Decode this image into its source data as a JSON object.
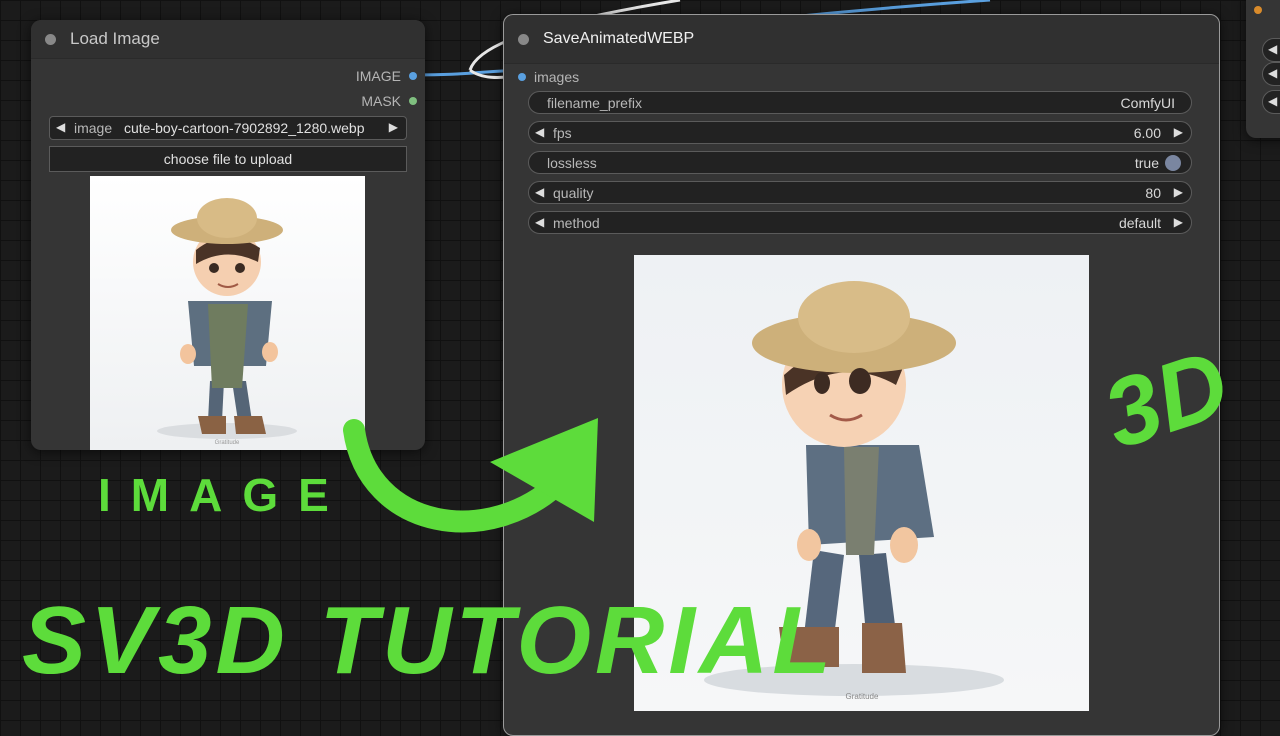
{
  "colors": {
    "accent_green": "#5ddc3b",
    "image_wire": "#5aa0e0",
    "mask_slot": "#7fbf7f"
  },
  "load_image_node": {
    "title": "Load Image",
    "outputs": [
      "IMAGE",
      "MASK"
    ],
    "image_widget": {
      "label": "image",
      "value": "cute-boy-cartoon-7902892_1280.webp"
    },
    "upload_button": "choose file to upload",
    "preview_caption": "Gratitude"
  },
  "save_node": {
    "title": "SaveAnimatedWEBP",
    "input": "images",
    "widgets": {
      "filename_prefix": {
        "label": "filename_prefix",
        "value": "ComfyUI"
      },
      "fps": {
        "label": "fps",
        "value": "6.00"
      },
      "lossless": {
        "label": "lossless",
        "value": "true"
      },
      "quality": {
        "label": "quality",
        "value": "80"
      },
      "method": {
        "label": "method",
        "value": "default"
      }
    },
    "preview_caption": "Gratitude"
  },
  "overlay": {
    "image_label": "IMAGE",
    "three_d_label": "3D",
    "tutorial_title": "SV3D TUTORIAL"
  }
}
